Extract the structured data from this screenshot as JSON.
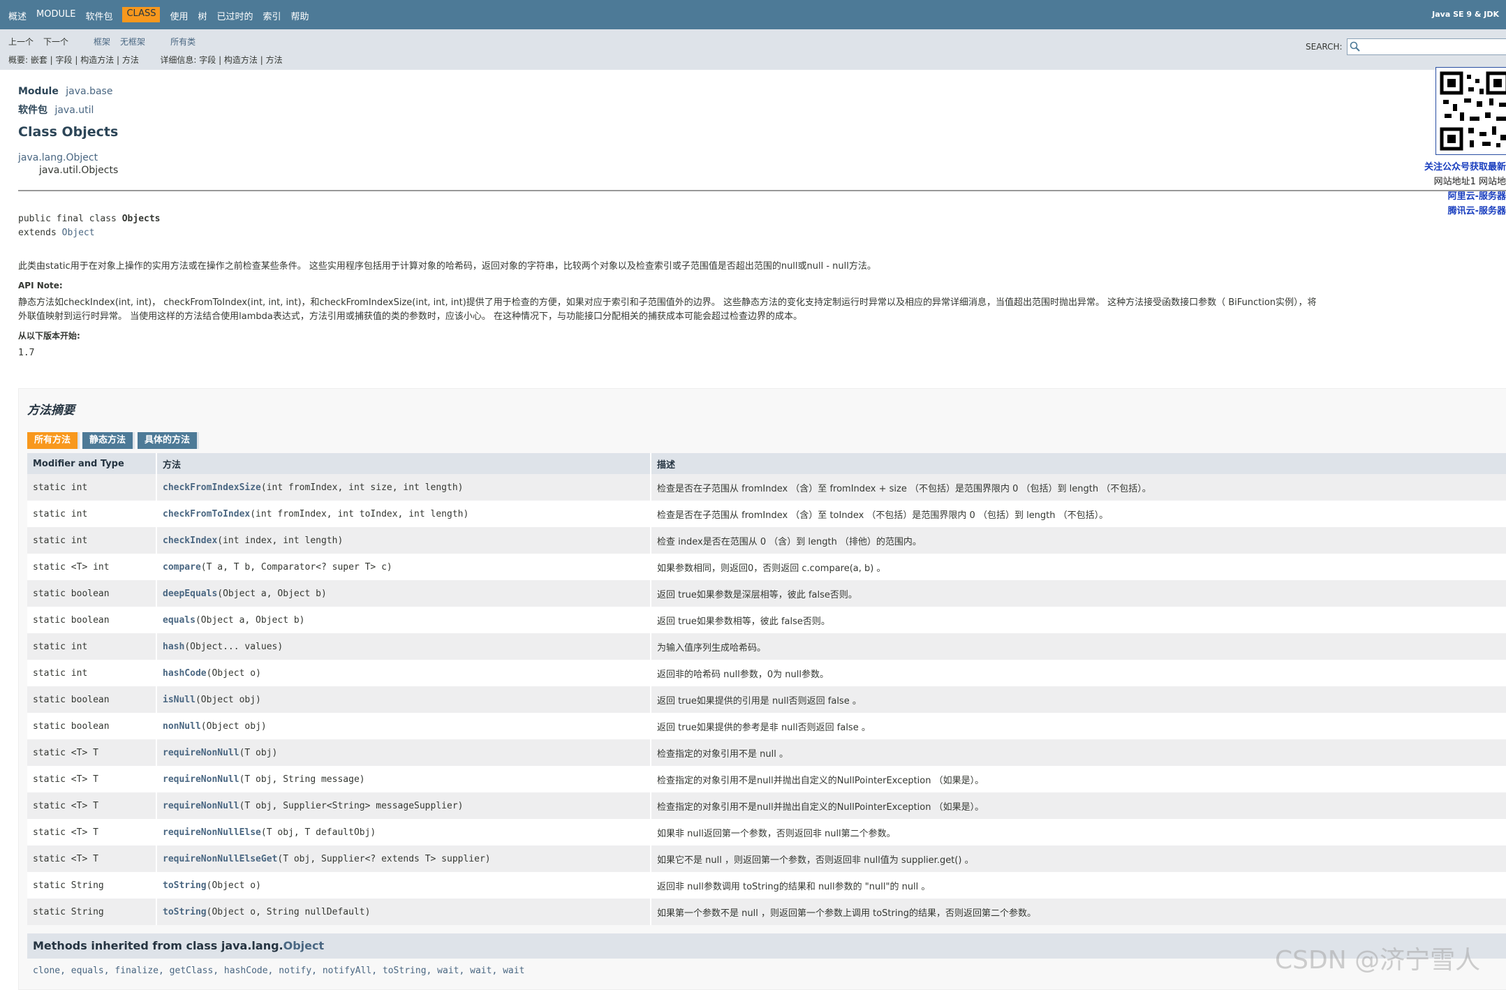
{
  "topnav": {
    "items": [
      "概述",
      "MODULE",
      "软件包",
      "CLASS",
      "使用",
      "树",
      "已过时的",
      "索引",
      "帮助"
    ],
    "active": "CLASS",
    "jdk_label": "Java SE 9 & JDK"
  },
  "subnav": {
    "prev": "上一个",
    "next": "下一个",
    "frames": "框架",
    "noframes": "无框架",
    "allclasses": "所有类",
    "summary_line": "概要: 嵌套 | 字段 | 构造方法 | 方法",
    "detail_line": "详细信息: 字段 | 构造方法 | 方法",
    "search_label": "SEARCH:"
  },
  "header": {
    "module_label": "Module",
    "module_value": "java.base",
    "package_label": "软件包",
    "package_value": "java.util",
    "class_title": "Class Objects",
    "inherit_parent": "java.lang.Object",
    "inherit_child": "java.util.Objects"
  },
  "signature": {
    "line1_prefix": "public final class ",
    "line1_name": "Objects",
    "line2_prefix": "extends ",
    "line2_link": "Object"
  },
  "description": "此类由static用于在对象上操作的实用方法或在操作之前检查某些条件。 这些实用程序包括用于计算对象的哈希码，返回对象的字符串，比较两个对象以及检查索引或子范围值是否超出范围的null或null - null方法。",
  "api_note_label": "API Note:",
  "api_note_line1": "静态方法如checkIndex(int, int)， checkFromToIndex(int, int, int)，和checkFromIndexSize(int, int, int)提供了用于检查的方便，如果对应于索引和子范围值外的边界。 这些静态方法的变化支持定制运行时异常以及相应的异常详细消息，当值超出范围时抛出异常。 这种方法接受函数接口参数（ BiFunction实例），将",
  "api_note_line2": "外联值映射到运行时异常。 当使用这样的方法结合使用lambda表达式，方法引用或捕获值的类的参数时，应该小心。 在这种情况下，与功能接口分配相关的捕获成本可能会超过检查边界的成本。",
  "since_label": "从以下版本开始:",
  "since_value": "1.7",
  "qr": {
    "line1": "关注公众号获取最新",
    "line2": "网站地址1 网站地",
    "line3": "阿里云-服务器",
    "line4": "腾讯云-服务器"
  },
  "summary": {
    "title": "方法摘要",
    "tabs": [
      "所有方法",
      "静态方法",
      "具体的方法"
    ],
    "headers": [
      "Modifier and Type",
      "方法",
      "描述"
    ],
    "rows": [
      {
        "type": "static int",
        "name": "checkFromIndexSize",
        "params": "(int fromIndex, int size, int length)",
        "desc": "检查是否在子范围从 fromIndex （含）至 fromIndex + size （不包括）是范围界限内 0 （包括）到 length （不包括）。"
      },
      {
        "type": "static int",
        "name": "checkFromToIndex",
        "params": "(int fromIndex, int toIndex, int length)",
        "desc": "检查是否在子范围从 fromIndex （含）至 toIndex （不包括）是范围界限内 0 （包括）到 length （不包括）。"
      },
      {
        "type": "static int",
        "name": "checkIndex",
        "params": "(int index, int length)",
        "desc": "检查 index是否在范围从 0 （含）到 length （排他）的范围内。"
      },
      {
        "type": "static <T> int",
        "name": "compare",
        "params": "(T a, T b, Comparator<? super T> c)",
        "desc": "如果参数相同，则返回0，否则返回 c.compare(a, b) 。"
      },
      {
        "type": "static boolean",
        "name": "deepEquals",
        "params": "(Object a, Object b)",
        "desc": "返回 true如果参数是深层相等，彼此 false否则。"
      },
      {
        "type": "static boolean",
        "name": "equals",
        "params": "(Object a, Object b)",
        "desc": "返回 true如果参数相等，彼此 false否则。"
      },
      {
        "type": "static int",
        "name": "hash",
        "params": "(Object... values)",
        "desc": "为输入值序列生成哈希码。"
      },
      {
        "type": "static int",
        "name": "hashCode",
        "params": "(Object o)",
        "desc": "返回非的哈希码 null参数，0为 null参数。"
      },
      {
        "type": "static boolean",
        "name": "isNull",
        "params": "(Object obj)",
        "desc": "返回 true如果提供的引用是 null否则返回 false 。"
      },
      {
        "type": "static boolean",
        "name": "nonNull",
        "params": "(Object obj)",
        "desc": "返回 true如果提供的参考是非 null否则返回 false 。"
      },
      {
        "type": "static <T> T",
        "name": "requireNonNull",
        "params": "(T obj)",
        "desc": "检查指定的对象引用不是 null 。"
      },
      {
        "type": "static <T> T",
        "name": "requireNonNull",
        "params": "(T obj, String message)",
        "desc": "检查指定的对象引用不是null并抛出自定义的NullPointerException （如果是）。"
      },
      {
        "type": "static <T> T",
        "name": "requireNonNull",
        "params": "(T obj, Supplier<String> messageSupplier)",
        "desc": "检查指定的对象引用不是null并抛出自定义的NullPointerException （如果是）。"
      },
      {
        "type": "static <T> T",
        "name": "requireNonNullElse",
        "params": "(T obj, T defaultObj)",
        "desc": "如果非 null返回第一个参数，否则返回非 null第二个参数。"
      },
      {
        "type": "static <T> T",
        "name": "requireNonNullElseGet",
        "params": "(T obj, Supplier<? extends T> supplier)",
        "desc": "如果它不是 null ，则返回第一个参数，否则返回非 null值为 supplier.get() 。"
      },
      {
        "type": "static String",
        "name": "toString",
        "params": "(Object o)",
        "desc": "返回非 null参数调用 toString的结果和 null参数的 \"null\"的 null 。"
      },
      {
        "type": "static String",
        "name": "toString",
        "params": "(Object o, String nullDefault)",
        "desc": "如果第一个参数不是 null ，则返回第一个参数上调用 toString的结果，否则返回第二个参数。"
      }
    ],
    "inherited_prefix": "Methods inherited from class java.lang.",
    "inherited_link": "Object",
    "inherited_methods": "clone, equals, finalize, getClass, hashCode, notify, notifyAll, toString, wait, wait, wait"
  },
  "watermark": "CSDN @济宁雪人"
}
